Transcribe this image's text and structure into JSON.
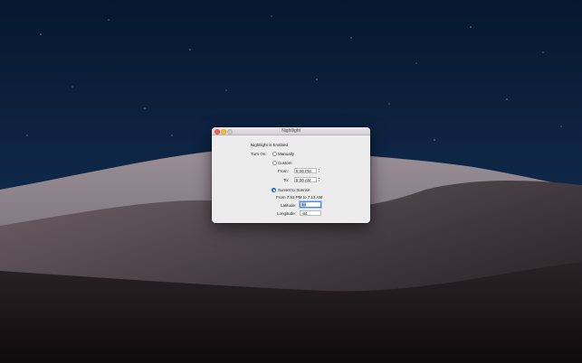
{
  "window": {
    "title": "Nightlight"
  },
  "status_text": "Nightlight is Enabled",
  "turn_on_label": "Turn On:",
  "options": {
    "manually_label": "Manually",
    "custom_label": "Custom",
    "sunset_label": "Sunset to Sunrise",
    "selected": "sunset"
  },
  "custom": {
    "from_label": "From:",
    "from_value": "8:00 PM",
    "to_label": "To:",
    "to_value": "8:00 AM"
  },
  "sunset": {
    "summary": "From 7:53 PM to 7:13 AM",
    "latitude_label": "Latitude:",
    "latitude_value": "34",
    "longitude_label": "Longitude:",
    "longitude_value": "-84"
  },
  "colors": {
    "accent": "#2f7cf6",
    "close": "#fe5f57",
    "minimize": "#febc2e"
  }
}
